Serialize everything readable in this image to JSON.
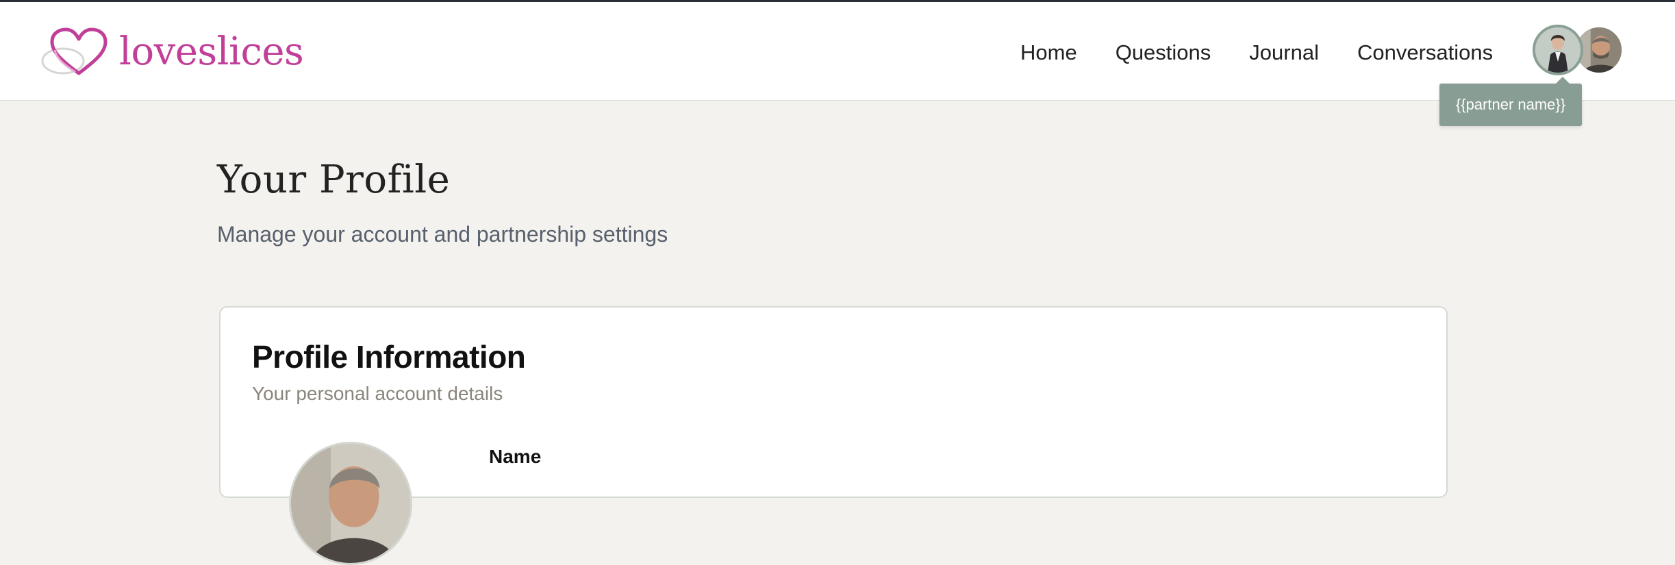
{
  "brand": {
    "name": "loveslices",
    "color": "#c13f98"
  },
  "nav": {
    "items": [
      {
        "label": "Home"
      },
      {
        "label": "Questions"
      },
      {
        "label": "Journal"
      },
      {
        "label": "Conversations"
      }
    ]
  },
  "avatars": {
    "partner_icon": "avatar-partner-icon",
    "user_icon": "avatar-user-icon",
    "ring_color": "#8aa095"
  },
  "tooltip": {
    "text": "{{partner name}}",
    "color": "#889d94"
  },
  "page": {
    "title": "Your Profile",
    "subtitle": "Manage your account and partnership settings"
  },
  "profile_card": {
    "title": "Profile Information",
    "subtitle": "Your personal account details",
    "field_label": "Name"
  }
}
